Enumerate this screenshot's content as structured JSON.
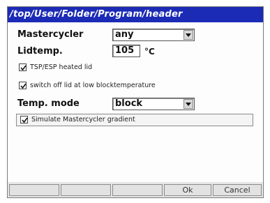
{
  "window": {
    "title": "/top/User/Folder/Program/header"
  },
  "fields": {
    "mastercycler_label": "Mastercycler",
    "mastercycler_value": "any",
    "lidtemp_label": "Lidtemp.",
    "lidtemp_value": "105",
    "lidtemp_unit": "°C",
    "tsp_esp_label": "TSP/ESP heated lid",
    "tsp_esp_checked": true,
    "switch_off_label": "switch off lid at low blocktemperature",
    "switch_off_checked": true,
    "temp_mode_label": "Temp. mode",
    "temp_mode_value": "block",
    "simulate_label": "Simulate Mastercycler gradient",
    "simulate_checked": true
  },
  "footer": {
    "ok_label": "Ok",
    "cancel_label": "Cancel"
  },
  "colors": {
    "titlebar": "#1b2bb6",
    "background": "#fdfdfd"
  }
}
